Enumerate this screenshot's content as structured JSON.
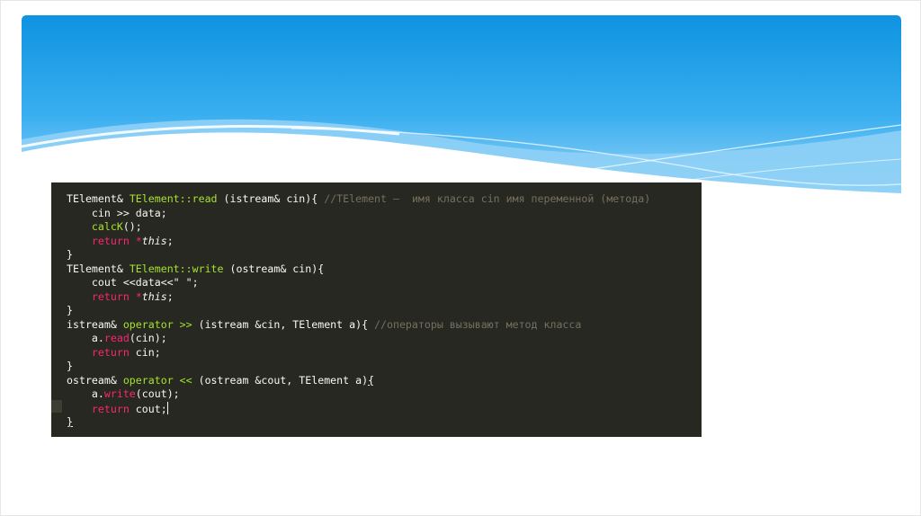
{
  "slide": {
    "colors": {
      "banner_top": "#0f93e0",
      "banner_mid": "#38aef0",
      "banner_bottom": "#9bd4f7",
      "code_background": "#272822"
    }
  },
  "editor": {
    "syntax_colors": {
      "plain": "#f8f8f2",
      "entity": "#a6e22e",
      "keyword": "#f92672",
      "comment": "#75715e"
    },
    "lines": [
      [
        {
          "t": "TElement& ",
          "c": "plain"
        },
        {
          "t": "TElement::read",
          "c": "entity"
        },
        {
          "t": " (istream& cin){ ",
          "c": "plain"
        },
        {
          "t": "//TElement –  имя класса cin имя переменной (метода)",
          "c": "comment"
        }
      ],
      [
        {
          "t": "    cin >> data;",
          "c": "plain"
        }
      ],
      [
        {
          "t": "    ",
          "c": "plain"
        },
        {
          "t": "calcK",
          "c": "entity"
        },
        {
          "t": "();",
          "c": "plain"
        }
      ],
      [
        {
          "t": "    ",
          "c": "plain"
        },
        {
          "t": "return",
          "c": "keyword"
        },
        {
          "t": " ",
          "c": "plain"
        },
        {
          "t": "*",
          "c": "keyword"
        },
        {
          "t": "this",
          "c": "italic"
        },
        {
          "t": ";",
          "c": "plain"
        }
      ],
      [
        {
          "t": "}",
          "c": "plain"
        }
      ],
      [
        {
          "t": "TElement& ",
          "c": "plain"
        },
        {
          "t": "TElement::write",
          "c": "entity"
        },
        {
          "t": " (ostream& cin){",
          "c": "plain"
        }
      ],
      [
        {
          "t": "    cout <<data<<\" \";",
          "c": "plain"
        }
      ],
      [
        {
          "t": "    ",
          "c": "plain"
        },
        {
          "t": "return",
          "c": "keyword"
        },
        {
          "t": " ",
          "c": "plain"
        },
        {
          "t": "*",
          "c": "keyword"
        },
        {
          "t": "this",
          "c": "italic"
        },
        {
          "t": ";",
          "c": "plain"
        }
      ],
      [
        {
          "t": "}",
          "c": "plain"
        }
      ],
      [
        {
          "t": "istream& ",
          "c": "plain"
        },
        {
          "t": "operator >>",
          "c": "entity"
        },
        {
          "t": " (istream &cin, TElement a){ ",
          "c": "plain"
        },
        {
          "t": "//операторы вызывают метод класса",
          "c": "comment"
        }
      ],
      [
        {
          "t": "    a.",
          "c": "plain"
        },
        {
          "t": "read",
          "c": "keyword"
        },
        {
          "t": "(cin);",
          "c": "plain"
        }
      ],
      [
        {
          "t": "    ",
          "c": "plain"
        },
        {
          "t": "return",
          "c": "keyword"
        },
        {
          "t": " cin;",
          "c": "plain"
        }
      ],
      [
        {
          "t": "}",
          "c": "plain"
        }
      ],
      [
        {
          "t": "ostream& ",
          "c": "plain"
        },
        {
          "t": "operator <<",
          "c": "entity"
        },
        {
          "t": " (ostream &cout, TElement a)",
          "c": "plain"
        },
        {
          "t": "{",
          "c": "bracket"
        }
      ],
      [
        {
          "t": "    a.",
          "c": "plain"
        },
        {
          "t": "write",
          "c": "keyword"
        },
        {
          "t": "(cout);",
          "c": "plain"
        }
      ],
      [
        {
          "t": "    ",
          "c": "plain"
        },
        {
          "t": "return",
          "c": "keyword"
        },
        {
          "t": " cout;",
          "c": "plain"
        },
        {
          "t": "",
          "c": "caret"
        }
      ],
      [
        {
          "t": "}",
          "c": "bracket"
        }
      ]
    ]
  }
}
